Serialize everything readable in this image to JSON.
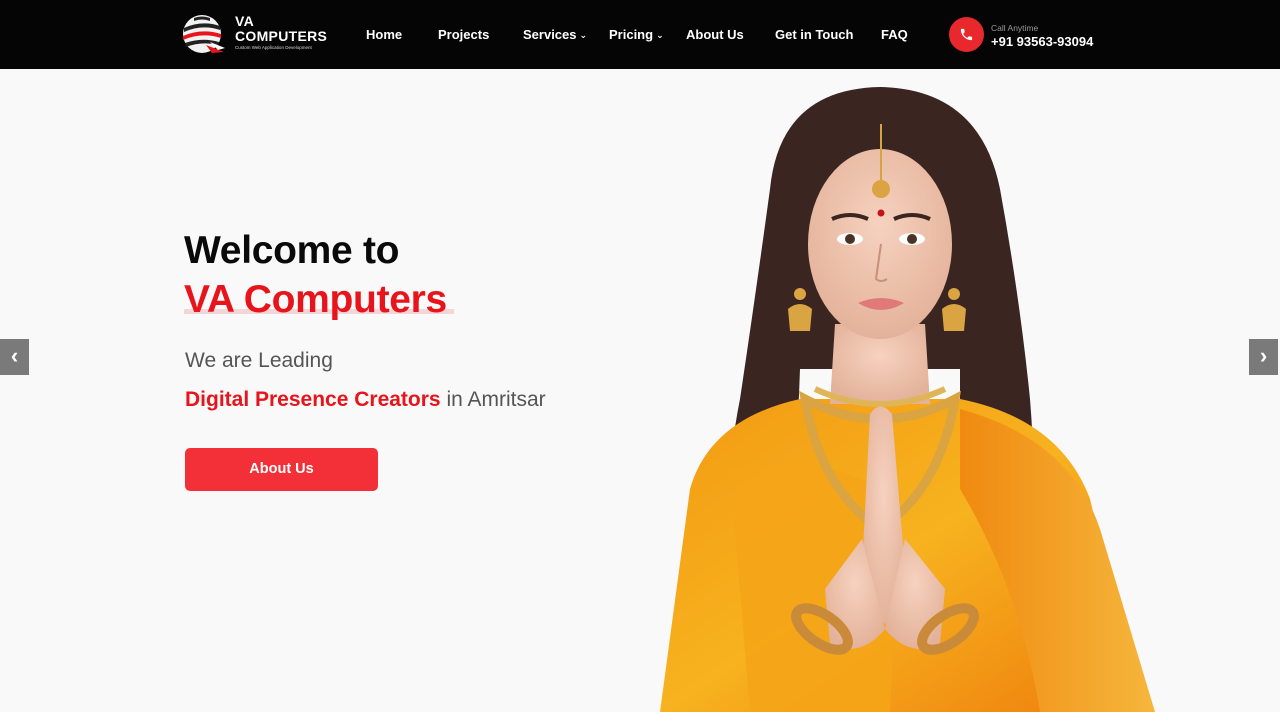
{
  "brand": {
    "name_line1": "VA",
    "name_line2": "COMPUTERS",
    "tagline": "Custom Web Application Development",
    "accent_color": "#e8141c"
  },
  "nav": {
    "items": [
      {
        "label": "Home"
      },
      {
        "label": "Projects"
      },
      {
        "label": "Services",
        "dropdown": true
      },
      {
        "label": "Pricing",
        "dropdown": true
      },
      {
        "label": "About Us"
      },
      {
        "label": "Get in Touch"
      },
      {
        "label": "FAQ"
      }
    ],
    "dropdown_caret": "⌄"
  },
  "contact": {
    "label": "Call Anytime",
    "number": "+91 93563-93094",
    "icon": "phone-icon"
  },
  "hero": {
    "title_line1": "Welcome to",
    "title_line2": "VA Computers",
    "subtitle_line1": "We are Leading",
    "subtitle_accent": "Digital Presence Creators",
    "subtitle_rest": " in Amritsar",
    "cta_label": "About Us",
    "prev_arrow": "‹",
    "next_arrow": "›"
  }
}
